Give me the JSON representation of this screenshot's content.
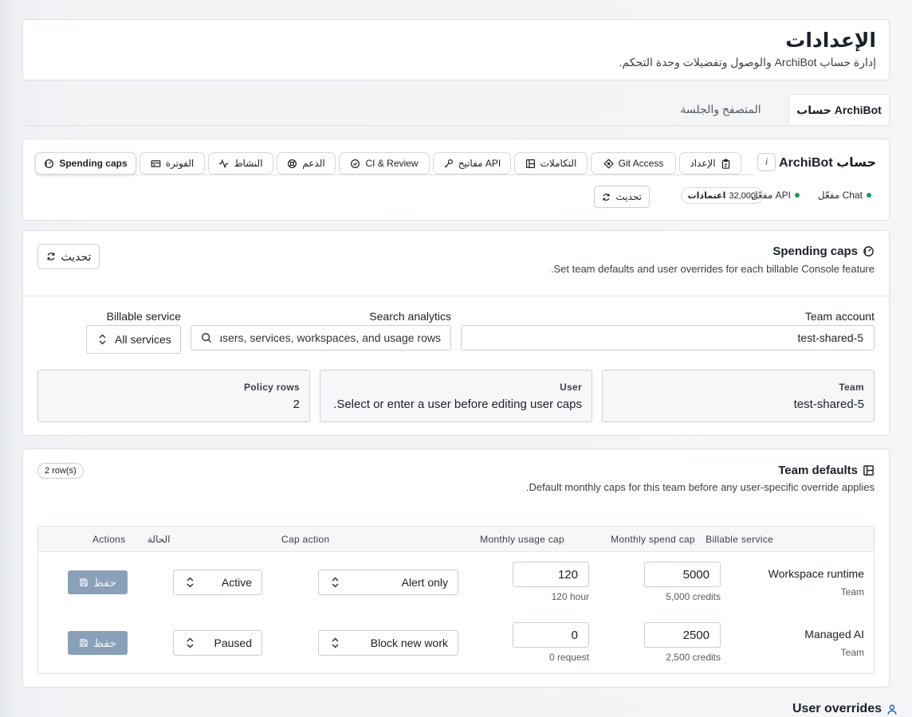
{
  "header": {
    "title": "الإعدادات",
    "subtitle": "إدارة حساب ArchiBot والوصول وتفضيلات وحدة التحكم."
  },
  "top_tabs": [
    {
      "label": "حساب ArchiBot",
      "active": true
    },
    {
      "label": "المتصفح والجلسة",
      "active": false
    }
  ],
  "account": {
    "name": "حساب ArchiBot",
    "info_label": "i",
    "chips": [
      {
        "label": "الإعداد",
        "icon": "clipboard-icon"
      },
      {
        "label": "Git Access",
        "icon": "git-icon"
      },
      {
        "label": "التكاملات",
        "icon": "integrations-icon"
      },
      {
        "label": "مفاتيح API",
        "icon": "key-icon"
      },
      {
        "label": "CI & Review",
        "icon": "check-circle-icon"
      },
      {
        "label": "الدعم",
        "icon": "lifebuoy-icon"
      },
      {
        "label": "النشاط",
        "icon": "activity-icon"
      },
      {
        "label": "الفوترة",
        "icon": "card-icon"
      },
      {
        "label": "Spending caps",
        "icon": "gauge-icon",
        "active": true
      }
    ],
    "status_chat": "Chat مفعّل",
    "status_api": "API مفعّل",
    "credits_value": "32,000",
    "credits_label": "اعتمادات",
    "refresh_label": "تحديث",
    "status_color": "#1f9d55"
  },
  "caps": {
    "title": "Spending caps",
    "subtitle": "Set team defaults and user overrides for each billable Console feature.",
    "refresh_label": "تحديث",
    "team_account_label": "Team account",
    "team_account_value": "test-shared-5",
    "search_label": "Search analytics",
    "search_placeholder": "Search users, services, workspaces, and usage rows",
    "service_label": "Billable service",
    "service_value": "All services",
    "stats": {
      "team_key": "Team",
      "team_value": "test-shared-5",
      "user_key": "User",
      "user_value": "Select or enter a user before editing user caps.",
      "rows_key": "Policy rows",
      "rows_value": "2"
    }
  },
  "team_defaults": {
    "title": "Team defaults",
    "subtitle": "Default monthly caps for this team before any user-specific override applies.",
    "badge": "2 row(s)",
    "columns": [
      "Billable service",
      "Monthly spend cap",
      "Monthly usage cap",
      "Cap action",
      "الحالة",
      "Actions"
    ],
    "rows": [
      {
        "service": "Workspace runtime",
        "scope": "Team",
        "spend": "5000",
        "spend_note": "5,000 credits",
        "usage": "120",
        "usage_note": "120 hour",
        "action": "Alert only",
        "status": "Active",
        "save": "حفظ"
      },
      {
        "service": "Managed AI",
        "scope": "Team",
        "spend": "2500",
        "spend_note": "2,500 credits",
        "usage": "0",
        "usage_note": "0 request",
        "action": "Block new work",
        "status": "Paused",
        "save": "حفظ"
      }
    ]
  },
  "user_overrides": {
    "title": "User overrides"
  }
}
